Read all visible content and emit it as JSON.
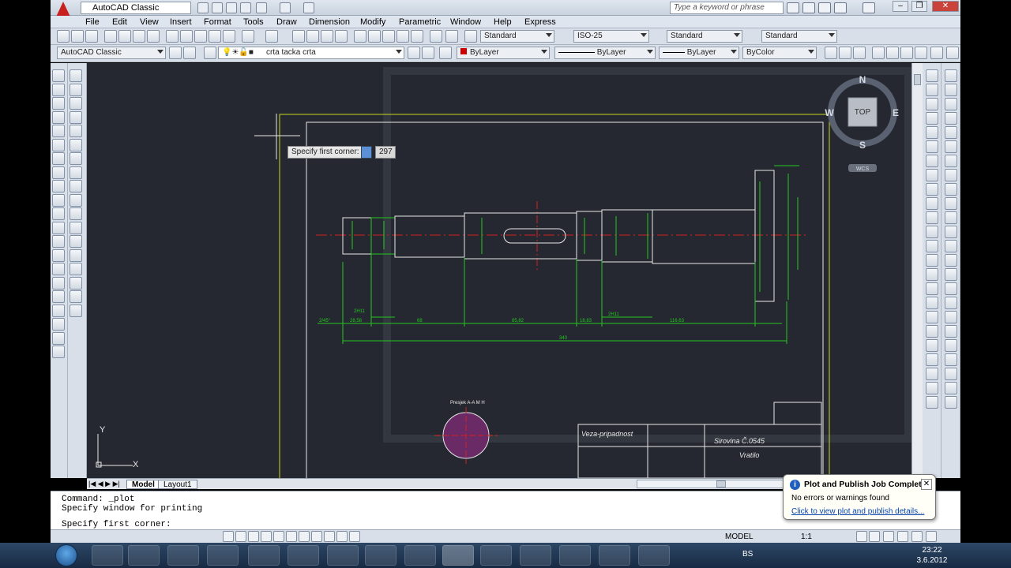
{
  "titlebar": {
    "workspace": "AutoCAD Classic",
    "search_placeholder": "Type a keyword or phrase"
  },
  "menu": [
    "File",
    "Edit",
    "View",
    "Insert",
    "Format",
    "Tools",
    "Draw",
    "Dimension",
    "Modify",
    "Parametric",
    "Window",
    "Help",
    "Express"
  ],
  "styles_toolbar": {
    "text_style": "Standard",
    "dim_style": "ISO-25",
    "table_style": "Standard",
    "multileader_style": "Standard"
  },
  "layers_toolbar": {
    "workspace": "AutoCAD Classic",
    "current_layer": "crta tacka crta",
    "color": "ByLayer",
    "linetype": "ByLayer",
    "lineweight": "ByLayer",
    "plotstyle": "ByColor"
  },
  "tooltip": {
    "prompt": "Specify first corner:",
    "value": "297"
  },
  "viewcube": {
    "north": "N",
    "south": "S",
    "east": "E",
    "west": "W",
    "face": "TOP",
    "ucs": "WCS"
  },
  "ucs_icon": {
    "x": "X",
    "y": "Y"
  },
  "drawing": {
    "dims": [
      "2/45°",
      "28,58",
      "2H11",
      "68",
      "85,82",
      "18,83",
      "2H11",
      "116,63",
      "340"
    ],
    "section_label": "Presjek A-A M H",
    "title_block": {
      "connection": "Veza-pripadnost",
      "material": "Sirovina  Č.0545",
      "name": "Vratilo"
    }
  },
  "layout_tabs": [
    "Model",
    "Layout1"
  ],
  "command_lines": [
    "Command: _plot",
    "Specify window for printing",
    "",
    "Specify first corner:"
  ],
  "statusbar": {
    "model": "MODEL",
    "scale": "1:1"
  },
  "notification": {
    "title": "Plot and Publish Job Complete",
    "message": "No errors or warnings found",
    "link": "Click to view plot and publish details..."
  },
  "taskbar": {
    "lang": "BS",
    "time": "23:22",
    "date": "3.6.2012"
  },
  "colors": {
    "drawing_bg": "#252830",
    "green_lines": "#22c81e",
    "white_lines": "#e8e8e8",
    "red_center": "#d42020"
  }
}
